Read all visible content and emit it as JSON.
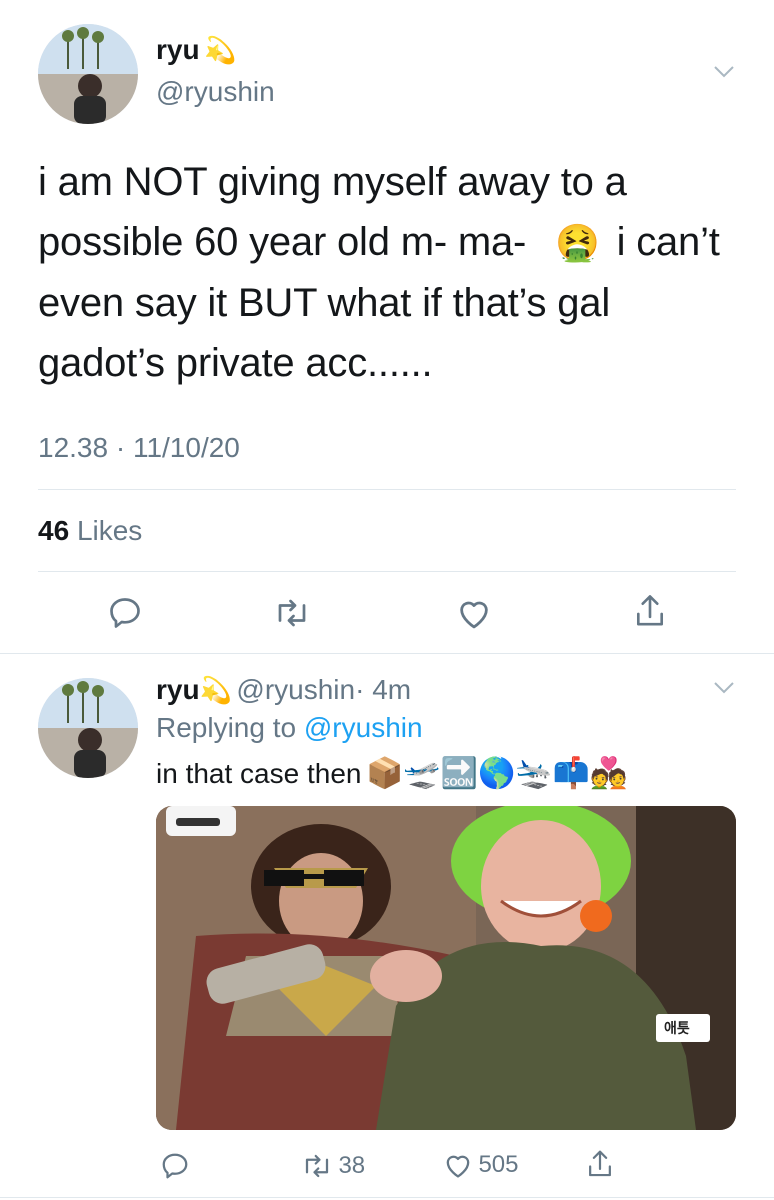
{
  "main_tweet": {
    "display_name": "ryu",
    "name_emoji": "💫",
    "handle": "@ryushin",
    "text_lines": [
      "i am NOT giving myself away to a",
      "possible 60 year old m- ma-",
      "i can’t",
      "even say it BUT what if that’s gal",
      "gadot’s private acc......"
    ],
    "inline_emoji": "🤮",
    "timestamp": "12.38 · 11/10/20",
    "likes_count": "46",
    "likes_label": "Likes",
    "actions": [
      "reply-icon",
      "retweet-icon",
      "like-icon",
      "share-icon"
    ]
  },
  "reply_tweet": {
    "display_name": "ryu",
    "name_emoji": "💫",
    "handle": "@ryushin",
    "time_ago": "· 4m",
    "replying_prefix": "Replying to",
    "replying_handle": "@ryushin",
    "text": "in that case then",
    "emojis": [
      "📦",
      "🛫",
      "🔜",
      "🌎",
      "🛬",
      "📫",
      "💑"
    ],
    "retweet_count": "38",
    "like_count": "505",
    "image_label": "애틋"
  }
}
